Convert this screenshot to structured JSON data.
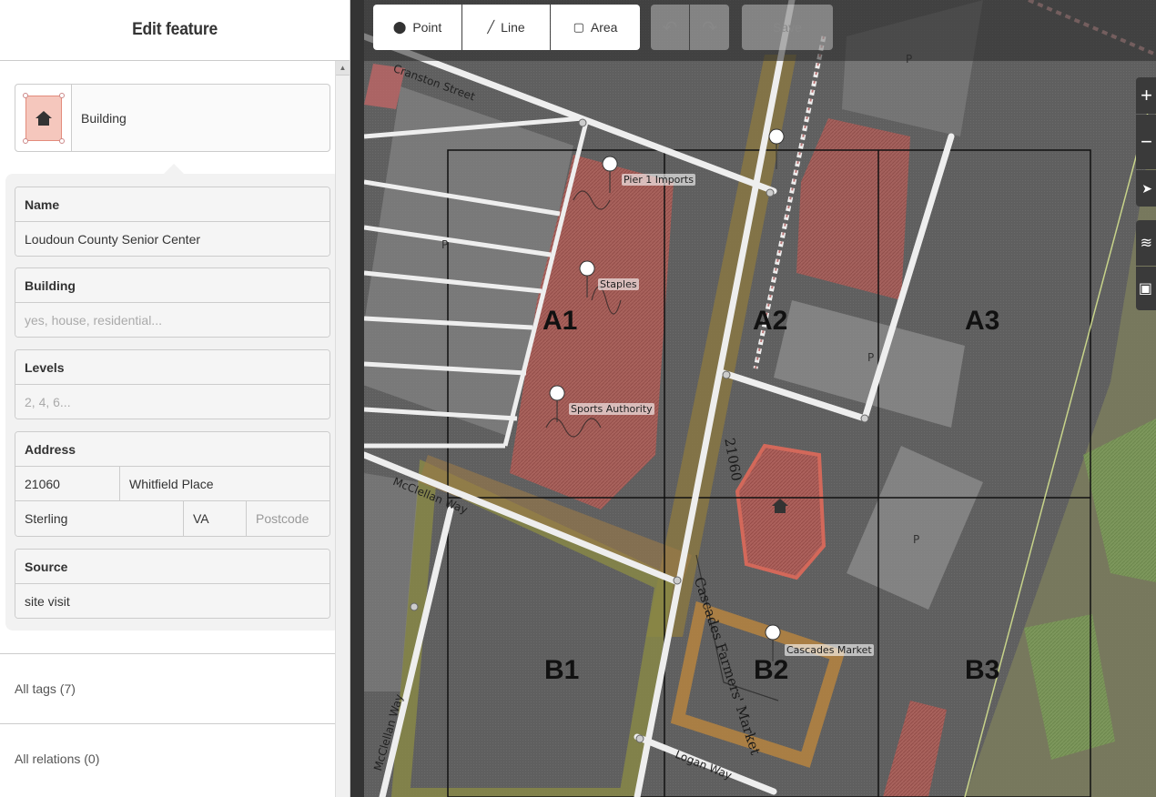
{
  "sidebar": {
    "title": "Edit feature",
    "preset_label": "Building",
    "fields": {
      "name": {
        "label": "Name",
        "value": "Loudoun County Senior Center"
      },
      "building": {
        "label": "Building",
        "placeholder": "yes, house, residential..."
      },
      "levels": {
        "label": "Levels",
        "placeholder": "2, 4, 6..."
      },
      "address": {
        "label": "Address",
        "housenumber": "21060",
        "street": "Whitfield Place",
        "city": "Sterling",
        "state": "VA",
        "postcode_placeholder": "Postcode"
      },
      "source": {
        "label": "Source",
        "value": "site visit"
      }
    },
    "all_tags": "All tags (7)",
    "all_relations": "All relations (0)"
  },
  "toolbar": {
    "point_label": "Point",
    "line_label": "Line",
    "area_label": "Area",
    "undo_icon": "↶",
    "redo_icon": "↷",
    "save_label": "Save"
  },
  "map": {
    "grid_labels": [
      "A1",
      "A2",
      "A3",
      "B1",
      "B2",
      "B3"
    ],
    "poi_labels": [
      "Pier 1 Imports",
      "Staples",
      "Sports Authority",
      "Cascades Market"
    ],
    "streets": [
      "Cranston Street",
      "McClellan Way",
      "McClellan Way",
      "Logan Way"
    ],
    "parking": "P",
    "handwriting": [
      "Cascades Farmers' Market",
      "21060"
    ],
    "controls": [
      "+",
      "−",
      "➤",
      "≋",
      "▣"
    ]
  },
  "colors": {
    "building_fill": "#c9716a",
    "park_fill": "#8fb26b",
    "parking_fill": "#aaaaaa",
    "road": "#f2f2f2",
    "orange_path": "#b8863e"
  }
}
